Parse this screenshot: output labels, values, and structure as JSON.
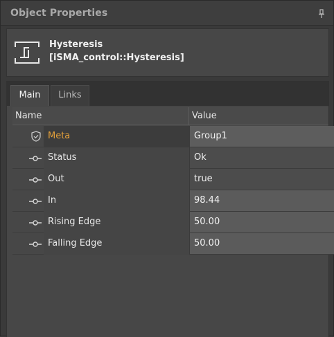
{
  "window": {
    "title": "Object Properties",
    "pin_icon": "pin-icon"
  },
  "object": {
    "name": "Hysteresis",
    "type": "[iSMA_control::Hysteresis]",
    "icon": "hysteresis-icon"
  },
  "tabs": [
    {
      "label": "Main",
      "active": true
    },
    {
      "label": "Links",
      "active": false
    }
  ],
  "grid": {
    "columns": {
      "name": "Name",
      "value": "Value"
    },
    "rows": [
      {
        "label": "Meta",
        "value": "Group1",
        "icon": "shield-icon"
      },
      {
        "label": "Status",
        "value": "Ok",
        "icon": "slot-connector-icon"
      },
      {
        "label": "Out",
        "value": "true",
        "icon": "slot-connector-icon"
      },
      {
        "label": "In",
        "value": "98.44",
        "icon": "slot-connector-icon"
      },
      {
        "label": "Rising Edge",
        "value": "50.00",
        "icon": "slot-connector-icon"
      },
      {
        "label": "Falling Edge",
        "value": "50.00",
        "icon": "slot-connector-icon"
      }
    ]
  },
  "colors": {
    "background": "#3a3a3a",
    "panel": "#474747",
    "meta_label": "#e5a13a",
    "text": "#e8e8e8"
  }
}
